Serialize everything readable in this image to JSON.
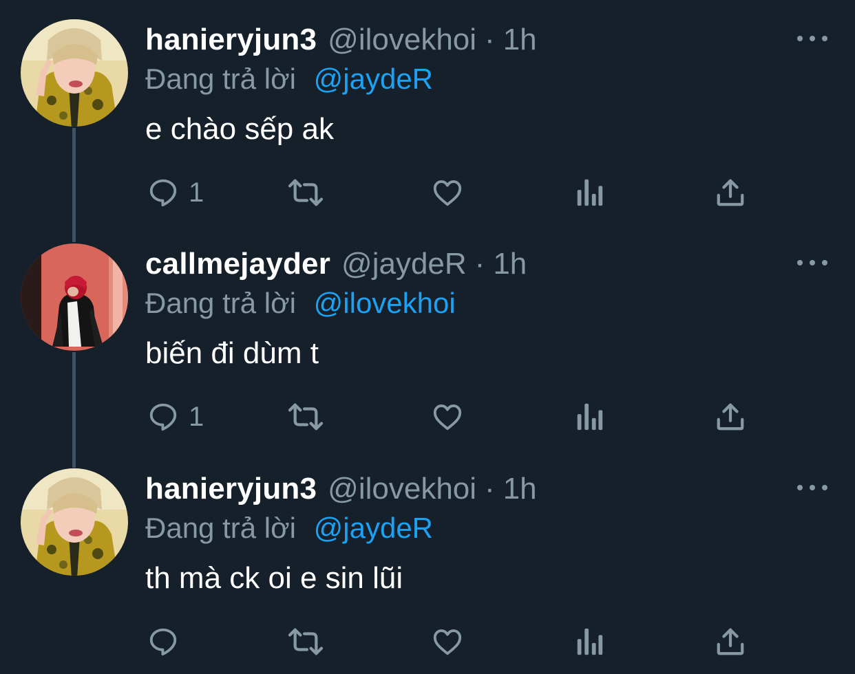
{
  "replying_prefix": "Đang trả lời",
  "colors": {
    "background": "#15202b",
    "primary_text": "#ffffff",
    "secondary_text": "#8899a6",
    "accent": "#1da1f2",
    "thread_line": "#3d5466"
  },
  "tweets": [
    {
      "display_name": "hanieryjun3",
      "handle": "@ilovekhoi",
      "separator": "·",
      "time": "1h",
      "replying_to": "@jaydeR",
      "text": "e chào sếp ak",
      "reply_count": "1",
      "avatar_icon": "avatar-person-yellow-camo-hoodie",
      "actions": [
        "reply-icon",
        "retweet-icon",
        "like-icon",
        "analytics-icon",
        "share-icon"
      ]
    },
    {
      "display_name": "callmejayder",
      "handle": "@jaydeR",
      "separator": "·",
      "time": "1h",
      "replying_to": "@ilovekhoi",
      "text": "biến đi dùm t",
      "reply_count": "1",
      "avatar_icon": "avatar-person-red-background-black-jacket",
      "actions": [
        "reply-icon",
        "retweet-icon",
        "like-icon",
        "analytics-icon",
        "share-icon"
      ]
    },
    {
      "display_name": "hanieryjun3",
      "handle": "@ilovekhoi",
      "separator": "·",
      "time": "1h",
      "replying_to": "@jaydeR",
      "text": "th mà ck oi e sin lũi",
      "reply_count": "",
      "avatar_icon": "avatar-person-yellow-camo-hoodie",
      "actions": [
        "reply-icon",
        "retweet-icon",
        "like-icon",
        "analytics-icon",
        "share-icon"
      ]
    }
  ]
}
